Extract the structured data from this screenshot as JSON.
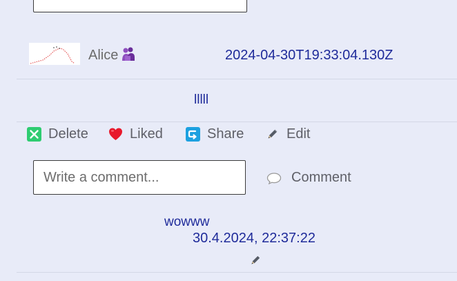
{
  "post": {
    "author": "Alice",
    "timestamp": "2024-04-30T19:33:04.130Z",
    "content": "lllll"
  },
  "actions": {
    "delete_label": "Delete",
    "liked_label": "Liked",
    "share_label": "Share",
    "edit_label": "Edit"
  },
  "comment_form": {
    "placeholder": "Write a comment...",
    "value": "",
    "button_label": "Comment"
  },
  "comments": [
    {
      "text": "wowww",
      "date": "30.4.2024, 22:37:22"
    }
  ],
  "colors": {
    "background": "#e8ebf8",
    "link_text": "#1f2b9a",
    "muted_text": "#5f6068",
    "delete_green": "#2ecc71",
    "like_red": "#e8192c",
    "share_blue": "#1da1e0"
  },
  "icons": {
    "delete": "x-box-icon",
    "liked": "heart-icon",
    "share": "share-arrow-icon",
    "edit": "pencil-icon",
    "comment": "speech-bubble-icon",
    "author_emoji": "purple-figures-emoji-icon"
  }
}
